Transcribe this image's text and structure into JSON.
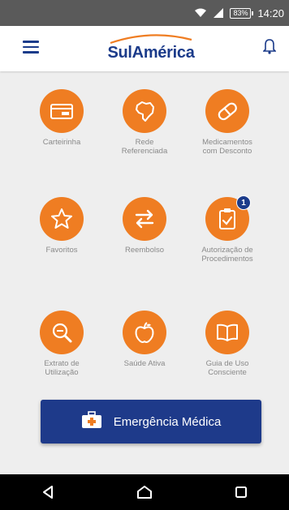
{
  "status_bar": {
    "time": "14:20",
    "battery": "83%",
    "icons": [
      "wifi-icon",
      "signal-icon",
      "battery-icon"
    ]
  },
  "app_bar": {
    "logo_text": "SulAmérica",
    "menu_icon": "hamburger-menu-icon",
    "notification_icon": "bell-icon"
  },
  "tiles": [
    {
      "label": "Carteirinha",
      "icon": "card-icon"
    },
    {
      "label": "Rede\nReferenciada",
      "icon": "brazil-map-icon"
    },
    {
      "label": "Medicamentos\ncom Desconto",
      "icon": "pill-icon"
    },
    {
      "label": "Favoritos",
      "icon": "star-icon"
    },
    {
      "label": "Reembolso",
      "icon": "swap-arrows-icon"
    },
    {
      "label": "Autorização de\nProcedimentos",
      "icon": "clipboard-check-icon",
      "badge": "1"
    },
    {
      "label": "Extrato de\nUtilização",
      "icon": "magnifier-icon"
    },
    {
      "label": "Saúde Ativa",
      "icon": "apple-icon"
    },
    {
      "label": "Guia de Uso\nConsciente",
      "icon": "book-icon"
    }
  ],
  "emergency_button": {
    "label": "Emergência Médica",
    "icon": "first-aid-kit-icon"
  },
  "nav_bar": {
    "buttons": [
      "back-icon",
      "home-icon",
      "recents-icon"
    ]
  },
  "colors": {
    "brand_blue": "#1b3b8a",
    "accent_orange": "#ef7d22",
    "label_gray": "#8a8a8a",
    "background": "#eeeeee"
  }
}
